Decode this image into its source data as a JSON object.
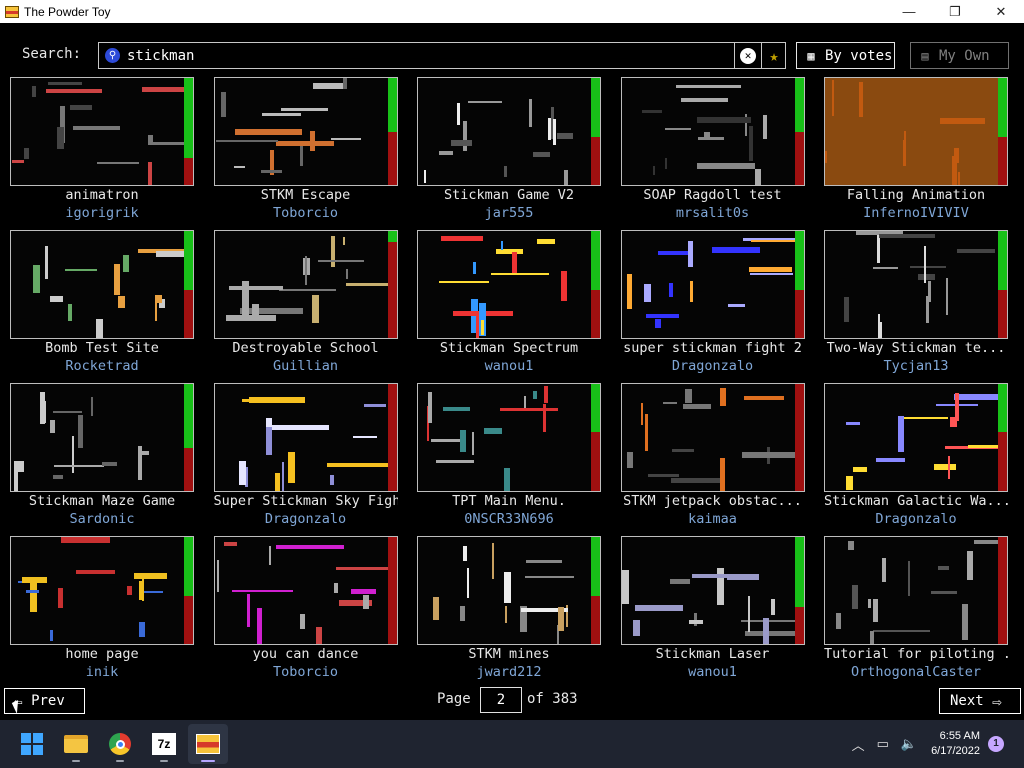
{
  "window": {
    "title": "The Powder Toy",
    "minimize": "—",
    "maximize": "❐",
    "close": "✕"
  },
  "search": {
    "label": "Search:",
    "value": "stickman"
  },
  "toolbar": {
    "sort_label": "By votes",
    "own_label": "My Own"
  },
  "saves": [
    {
      "title": "animatron",
      "author": "igorigrik",
      "score_fraction": 0.75
    },
    {
      "title": "STKM Escape",
      "author": "Toborcio",
      "score_fraction": 0.5
    },
    {
      "title": "Stickman Game V2",
      "author": "jar555",
      "score_fraction": 0.55
    },
    {
      "title": "SOAP Ragdoll test",
      "author": "mrsalit0s",
      "score_fraction": 0.5
    },
    {
      "title": "Falling Animation",
      "author": "InfernoIVIVIV",
      "score_fraction": 0.55
    },
    {
      "title": "Bomb Test Site",
      "author": "Rocketrad",
      "score_fraction": 0.55
    },
    {
      "title": "Destroyable School",
      "author": "Guillian",
      "score_fraction": 0.1
    },
    {
      "title": "Stickman Spectrum",
      "author": "wanou1",
      "score_fraction": 0.55
    },
    {
      "title": "super stickman fight 2",
      "author": "Dragonzalo",
      "score_fraction": 0.55
    },
    {
      "title": "Two-Way Stickman te...",
      "author": "Tycjan13",
      "score_fraction": 0.55
    },
    {
      "title": "Stickman Maze Game",
      "author": "Sardonic",
      "score_fraction": 0.6
    },
    {
      "title": "Super Stickman Sky Fight",
      "author": "Dragonzalo",
      "score_fraction": 0.0
    },
    {
      "title": "TPT Main Menu.",
      "author": "0NSCR33N696",
      "score_fraction": 0.45
    },
    {
      "title": "STKM jetpack obstac...",
      "author": "kaimaa",
      "score_fraction": 0.0
    },
    {
      "title": "Stickman Galactic Wa...",
      "author": "Dragonzalo",
      "score_fraction": 0.45
    },
    {
      "title": "home page",
      "author": "inik",
      "score_fraction": 0.55
    },
    {
      "title": "you can dance",
      "author": "Toborcio",
      "score_fraction": 0.0
    },
    {
      "title": "STKM mines",
      "author": "jward212",
      "score_fraction": 0.55
    },
    {
      "title": "Stickman Laser",
      "author": "wanou1",
      "score_fraction": 0.65
    },
    {
      "title": "Tutorial for piloting ...",
      "author": "OrthogonalCaster",
      "score_fraction": 0.0
    }
  ],
  "pagination": {
    "prev_label": "Prev",
    "next_label": "Next",
    "page_label": "Page",
    "current_page": "2",
    "of_label": "of 383"
  },
  "taskbar": {
    "apps": [
      "start-icon",
      "file-explorer-icon",
      "chrome-icon",
      "7zip-icon",
      "powder-toy-icon"
    ],
    "sevenz_label": "7z",
    "time": "6:55 AM",
    "date": "6/17/2022",
    "notification_count": "1"
  },
  "colors": {
    "vote_up": "#18c018",
    "vote_down": "#a01010",
    "author": "#7fa6d6",
    "taskbar": "#1f2430"
  }
}
